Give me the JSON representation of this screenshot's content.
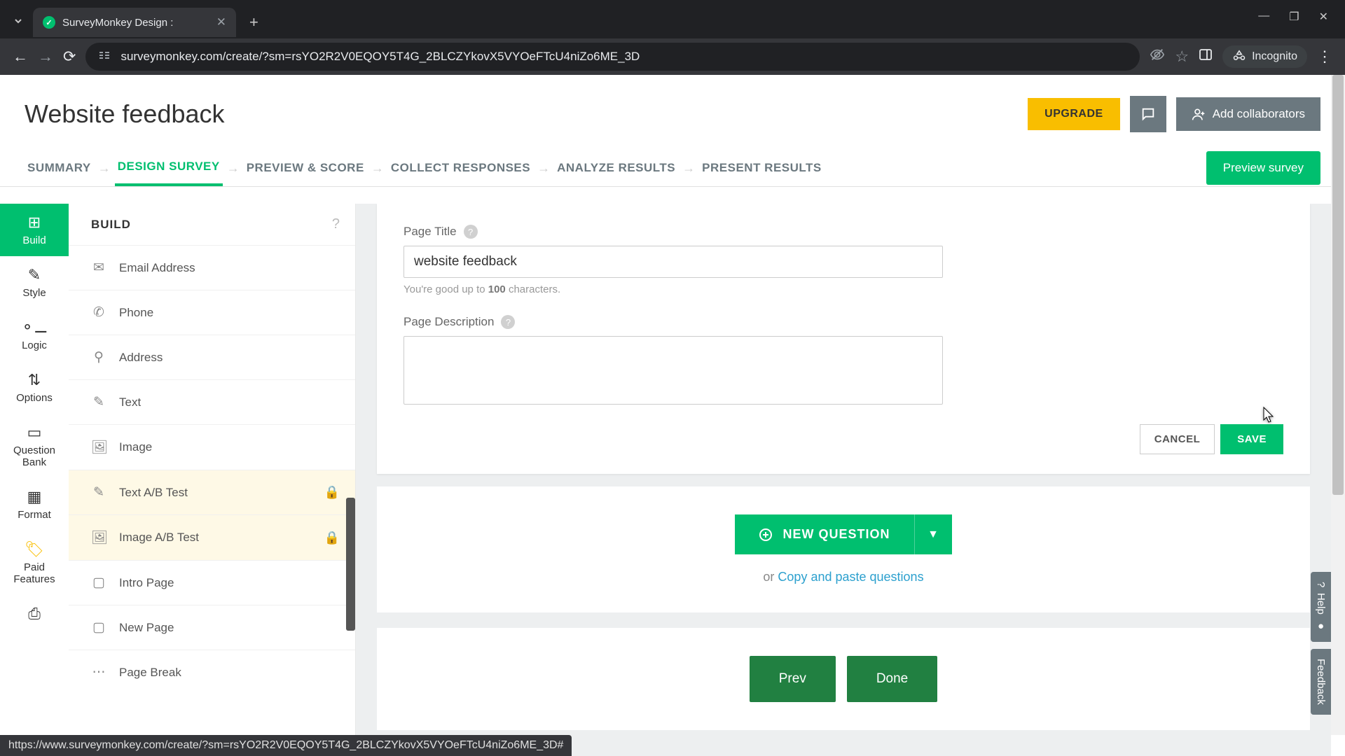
{
  "browser": {
    "tab_title": "SurveyMonkey Design :",
    "url": "surveymonkey.com/create/?sm=rsYO2R2V0EQOY5T4G_2BLCZYkovX5VYOeFTcU4niZo6ME_3D",
    "incognito_label": "Incognito",
    "status_url": "https://www.surveymonkey.com/create/?sm=rsYO2R2V0EQOY5T4G_2BLCZYkovX5VYOeFTcU4niZo6ME_3D#"
  },
  "header": {
    "title": "Website feedback",
    "upgrade": "UPGRADE",
    "add_collab": "Add collaborators"
  },
  "nav": {
    "summary": "SUMMARY",
    "design": "DESIGN SURVEY",
    "preview": "PREVIEW & SCORE",
    "collect": "COLLECT RESPONSES",
    "analyze": "ANALYZE RESULTS",
    "present": "PRESENT RESULTS",
    "preview_btn": "Preview survey"
  },
  "rail": {
    "build": "Build",
    "style": "Style",
    "logic": "Logic",
    "options": "Options",
    "qbank": "Question Bank",
    "format": "Format",
    "paid": "Paid Features"
  },
  "build": {
    "title": "BUILD",
    "items": {
      "email": "Email Address",
      "phone": "Phone",
      "address": "Address",
      "text": "Text",
      "image": "Image",
      "textab": "Text A/B Test",
      "imageab": "Image A/B Test",
      "intro": "Intro Page",
      "newpage": "New Page",
      "pagebreak": "Page Break"
    }
  },
  "editor": {
    "page_title_label": "Page Title",
    "page_title_value": "website feedback",
    "hint_pre": "You're good up to ",
    "hint_num": "100",
    "hint_post": " characters.",
    "page_desc_label": "Page Description",
    "cancel": "CANCEL",
    "save": "SAVE",
    "new_question": "NEW QUESTION",
    "copy_pre": "or ",
    "copy_link": "Copy and paste questions",
    "prev": "Prev",
    "done": "Done"
  },
  "side": {
    "help": "Help",
    "feedback": "Feedback"
  }
}
